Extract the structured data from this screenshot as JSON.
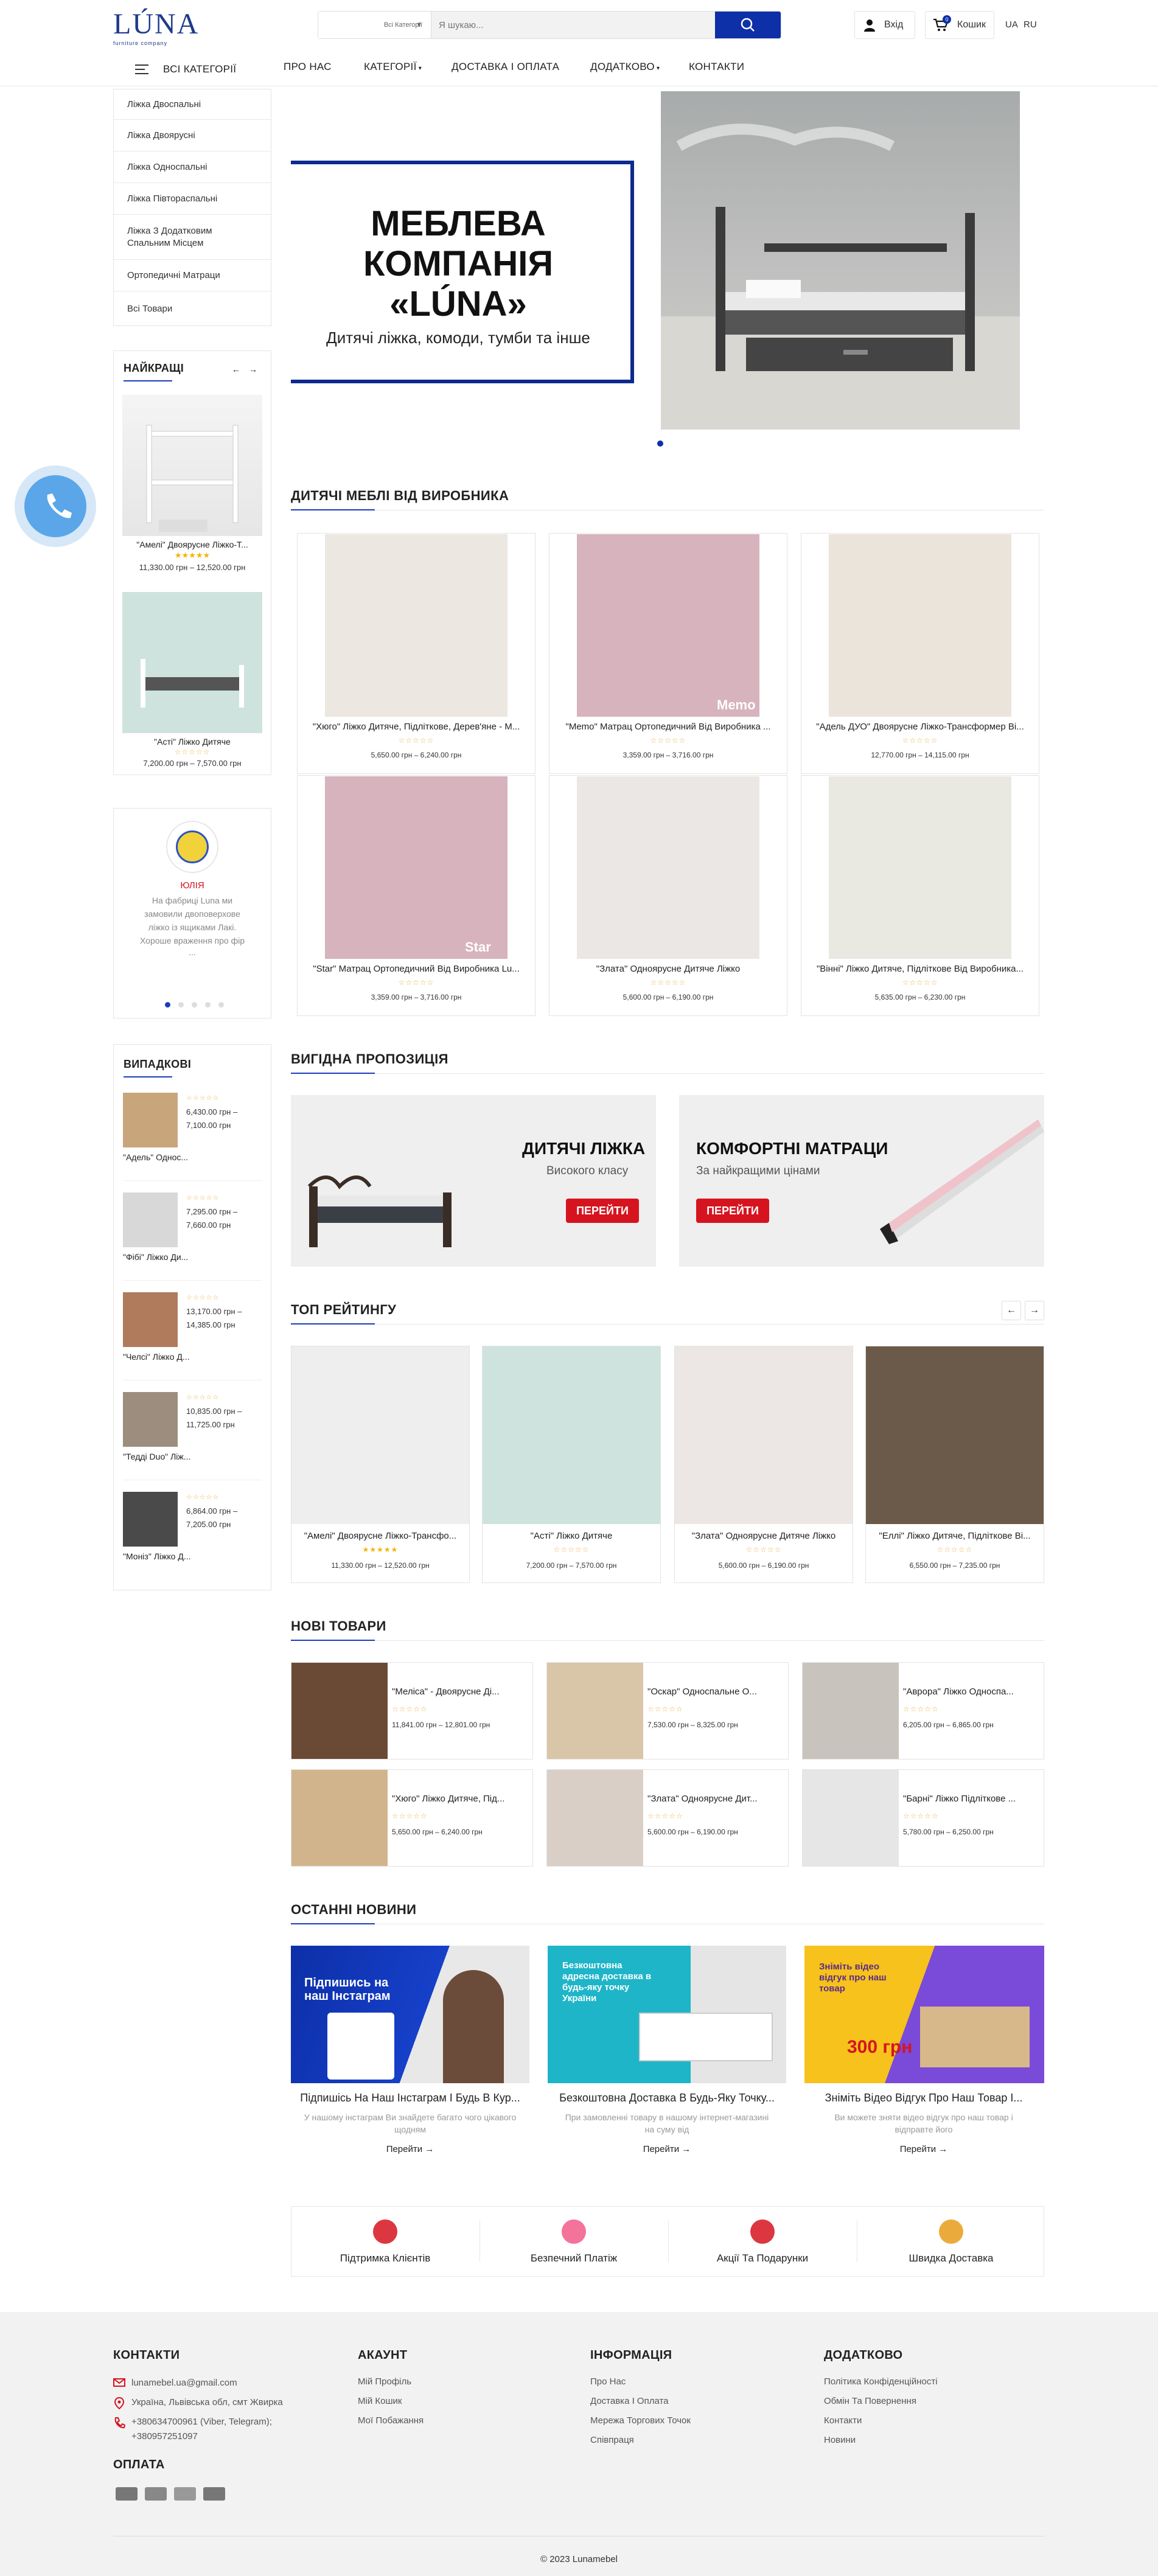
{
  "header": {
    "logo_text": "LÚNA",
    "logo_sub": "furniture company",
    "category_select": "Всі Категорії",
    "search_placeholder": "Я шукаю...",
    "login_label": "Вхід",
    "cart_label": "Кошик",
    "cart_count": "0",
    "lang_ua": "UA",
    "lang_ru": "RU"
  },
  "nav": {
    "all_categories": "ВСІ КАТЕГОРІЇ",
    "items": [
      "ПРО НАС",
      "КАТЕГОРІЇ",
      "ДОСТАВКА І ОПЛАТА",
      "ДОДАТКОВО",
      "КОНТАКТИ"
    ]
  },
  "sidebar": {
    "categories": [
      "Ліжка Двоспальні",
      "Ліжка Двоярусні",
      "Ліжка Односпальні",
      "Ліжка Півтораспальні",
      "Ліжка З Додатковим Спальним Місцем",
      "Ортопедичні Матраци",
      "Всі Товари"
    ],
    "bestsellers_title": "НАЙКРАЩІ",
    "bestsellers": [
      {
        "name": "\"Амелі\" Двоярусне Ліжко-Т...",
        "price": "11,330.00 грн – 12,520.00 грн"
      },
      {
        "name": "\"Асті\" Ліжко Дитяче",
        "price": "7,200.00 грн – 7,570.00 грн"
      }
    ],
    "review": {
      "name": "ЮЛІЯ",
      "text": "На фабриці Luna ми замовили двоповерхове ліжко із ящиками Лакі. Хороше враження про фір",
      "more": "..."
    },
    "random_title": "ВИПАДКОВІ",
    "random": [
      {
        "name": "\"Адель\" Однос...",
        "price1": "6,430.00 грн –",
        "price2": "7,100.00 грн"
      },
      {
        "name": "\"Фібі\" Ліжко Ди...",
        "price1": "7,295.00 грн –",
        "price2": "7,660.00 грн"
      },
      {
        "name": "\"Челсі\" Ліжко Д...",
        "price1": "13,170.00 грн –",
        "price2": "14,385.00 грн"
      },
      {
        "name": "\"Тедді Duo\" Ліж...",
        "price1": "10,835.00 грн –",
        "price2": "11,725.00 грн"
      },
      {
        "name": "\"Моніз\" Ліжко Д...",
        "price1": "6,864.00 грн –",
        "price2": "7,205.00 грн"
      }
    ]
  },
  "hero": {
    "title_line1": "МЕБЛЕВА",
    "title_line2": "КОМПАНІЯ",
    "title_line3": "«LÚNA»",
    "subtitle": "Дитячі ліжка, комоди, тумби та інше"
  },
  "section_kids": {
    "title": "ДИТЯЧІ МЕБЛІ ВІД ВИРОБНИКА",
    "products": [
      {
        "name": "\"Хюго\" Ліжко Дитяче, Підліткове, Дерев'яне - М...",
        "price": "5,650.00 грн – 6,240.00 грн"
      },
      {
        "name": "\"Memo\" Матрац Ортопедичний Від Виробника ...",
        "price": "3,359.00 грн – 3,716.00 грн",
        "img_label": "Memo"
      },
      {
        "name": "\"Адель ДУО\" Двоярусне Ліжко-Трансформер Ві...",
        "price": "12,770.00 грн – 14,115.00 грн"
      },
      {
        "name": "\"Star\" Матрац Ортопедичний Від Виробника Lu...",
        "price": "3,359.00 грн – 3,716.00 грн",
        "img_label": "Star"
      },
      {
        "name": "\"Злата\" Одноярусне Дитяче Ліжко",
        "price": "5,600.00 грн – 6,190.00 грн"
      },
      {
        "name": "\"Вінні\" Ліжко Дитяче, Підліткове Від Виробника...",
        "price": "5,635.00 грн – 6,230.00 грн"
      }
    ]
  },
  "section_offer": {
    "title": "ВИГІДНА ПРОПОЗИЦІЯ",
    "promo1": {
      "title": "ДИТЯЧІ ЛІЖКА",
      "sub": "Високого класу",
      "button": "ПЕРЕЙТИ"
    },
    "promo2": {
      "title": "КОМФОРТНІ МАТРАЦИ",
      "sub": "За найкращими цінами",
      "button": "ПЕРЕЙТИ"
    }
  },
  "section_top": {
    "title": "ТОП РЕЙТИНГУ",
    "products": [
      {
        "name": "\"Амелі\" Двоярусне Ліжко-Трансфо...",
        "price": "11,330.00 грн – 12,520.00 грн"
      },
      {
        "name": "\"Асті\" Ліжко Дитяче",
        "price": "7,200.00 грн – 7,570.00 грн"
      },
      {
        "name": "\"Злата\" Одноярусне Дитяче Ліжко",
        "price": "5,600.00 грн – 6,190.00 грн"
      },
      {
        "name": "\"Еллі\" Ліжко Дитяче, Підліткове Ві...",
        "price": "6,550.00 грн – 7,235.00 грн"
      }
    ]
  },
  "section_new": {
    "title": "НОВІ ТОВАРИ",
    "products": [
      {
        "name": "\"Меліса\" - Двоярусне Ді...",
        "price": "11,841.00 грн – 12,801.00 грн"
      },
      {
        "name": "\"Оскар\" Односпальне О...",
        "price": "7,530.00 грн – 8,325.00 грн"
      },
      {
        "name": "\"Аврора\" Ліжко Односпа...",
        "price": "6,205.00 грн – 6,865.00 грн"
      },
      {
        "name": "\"Хюго\" Ліжко Дитяче, Під...",
        "price": "5,650.00 грн – 6,240.00 грн"
      },
      {
        "name": "\"Злата\" Одноярусне Дит...",
        "price": "5,600.00 грн – 6,190.00 грн"
      },
      {
        "name": "\"Барні\" Ліжко Підліткове ...",
        "price": "5,780.00 грн – 6,250.00 грн"
      }
    ]
  },
  "section_news": {
    "title": "ОСТАННІ НОВИНИ",
    "more_label": "Перейти →",
    "posts": [
      {
        "title": "Підпишісь На Наш Інстаграм І Будь В Кур...",
        "desc": "У нашому інстаграм Ви знайдете багато чого цікавого щодням",
        "img_text": "Підпишись на наш Інстаграм"
      },
      {
        "title": "Безкоштовна Доставка В Будь-Яку Точку...",
        "desc": "При замовленні товару в нашому інтернет-магазині на суму від",
        "img_text": "Безкоштовна адресна доставка в будь-яку точку України"
      },
      {
        "title": "Зніміть Відео Відгук Про Наш Товар І...",
        "desc": "Ви можете зняти відео відгук про наш товар і відправте його",
        "img_text": "Зніміть відео відгук про наш товар",
        "img_price": "300 грн"
      }
    ]
  },
  "features": [
    {
      "label": "Підтримка Клієнтів",
      "icon": "support-icon"
    },
    {
      "label": "Безпечний Платіж",
      "icon": "piggy-bank-icon"
    },
    {
      "label": "Акції Та Подарунки",
      "icon": "gift-icon"
    },
    {
      "label": "Швидка Доставка",
      "icon": "truck-icon"
    }
  ],
  "footer": {
    "contacts_title": "КОНТАКТИ",
    "email": "lunamebel.ua@gmail.com",
    "address": "Україна, Львівська обл, смт Жвирка",
    "phone1": "+380634700961 (Viber, Telegram);",
    "phone2": "+380957251097",
    "payment_title": "ОПЛАТА",
    "account_title": "АКАУНТ",
    "account_links": [
      "Мій Профіль",
      "Мій Кошик",
      "Мої Побажання"
    ],
    "info_title": "ІНФОРМАЦІЯ",
    "info_links": [
      "Про Нас",
      "Доставка І Оплата",
      "Мережа Торгових Точок",
      "Співпраця"
    ],
    "extra_title": "ДОДАТКОВО",
    "extra_links": [
      "Політика Конфіденційності",
      "Обмін Та Повернення",
      "Контакти",
      "Новини"
    ],
    "copyright": "© 2023 Lunamebel"
  },
  "colors": {
    "brand_blue": "#0d2fa8",
    "accent_red": "#d6141f",
    "star_gold": "#f3b400"
  }
}
